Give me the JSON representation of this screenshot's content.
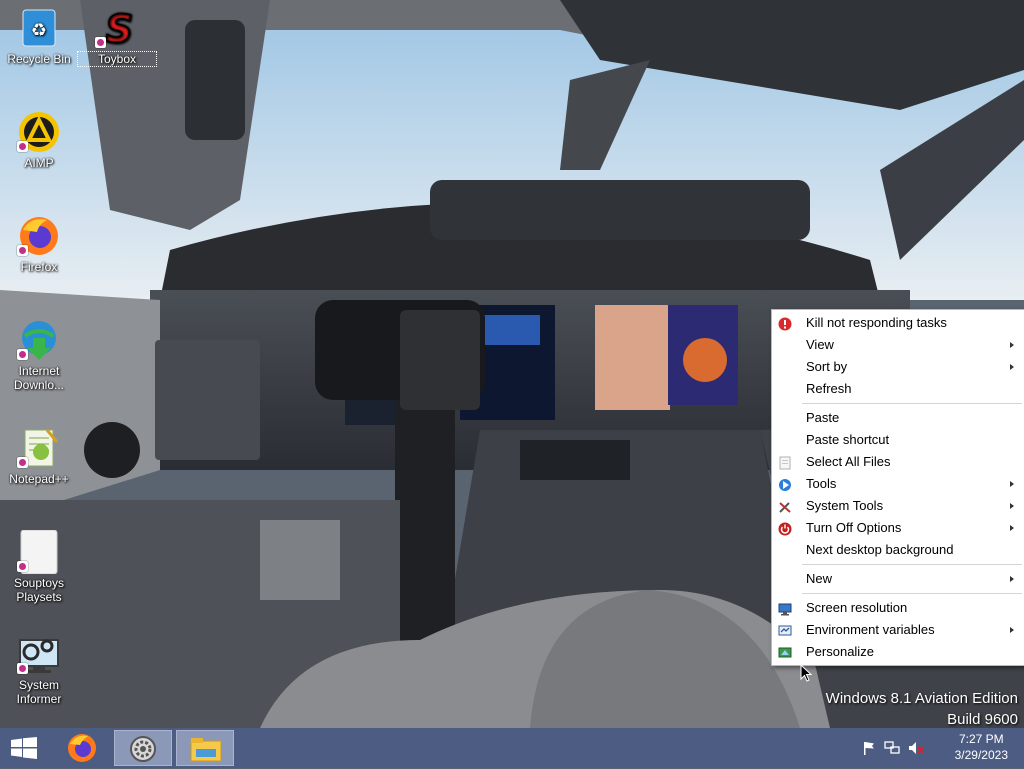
{
  "desktop": {
    "icons": [
      {
        "label": "Recycle Bin",
        "icon": "recycle-bin-icon"
      },
      {
        "label": "Toybox",
        "icon": "toybox-icon"
      },
      {
        "label": "AIMP",
        "icon": "aimp-icon"
      },
      {
        "label": "Firefox",
        "icon": "firefox-icon"
      },
      {
        "label": "Internet Downlo...",
        "icon": "internet-download-manager-icon"
      },
      {
        "label": "Notepad++",
        "icon": "notepad-plus-plus-icon"
      },
      {
        "label": "Souptoys Playsets",
        "icon": "souptoys-icon"
      },
      {
        "label": "System Informer",
        "icon": "system-informer-icon"
      }
    ]
  },
  "context_menu": {
    "items": [
      {
        "label": "Kill not responding tasks",
        "icon": "kill-task-icon",
        "submenu": false
      },
      {
        "label": "View",
        "icon": "",
        "submenu": true
      },
      {
        "label": "Sort by",
        "icon": "",
        "submenu": true
      },
      {
        "label": "Refresh",
        "icon": "",
        "submenu": false
      },
      {
        "label": "Paste",
        "icon": "",
        "submenu": false
      },
      {
        "label": "Paste shortcut",
        "icon": "",
        "submenu": false
      },
      {
        "label": "Select All Files",
        "icon": "select-all-icon",
        "submenu": false
      },
      {
        "label": "Tools",
        "icon": "tools-icon",
        "submenu": true
      },
      {
        "label": "System Tools",
        "icon": "system-tools-icon",
        "submenu": true
      },
      {
        "label": "Turn Off Options",
        "icon": "power-icon",
        "submenu": true
      },
      {
        "label": "Next desktop background",
        "icon": "",
        "submenu": false
      },
      {
        "label": "New",
        "icon": "",
        "submenu": true
      },
      {
        "label": "Screen resolution",
        "icon": "monitor-icon",
        "submenu": false
      },
      {
        "label": "Environment variables",
        "icon": "environment-icon",
        "submenu": true
      },
      {
        "label": "Personalize",
        "icon": "personalize-icon",
        "submenu": false
      }
    ]
  },
  "watermark": {
    "line1": "Windows 8.1 Aviation Edition",
    "line2": "Build 9600"
  },
  "taskbar": {
    "start": "start-icon",
    "pinned": [
      "firefox-icon",
      "settings-icon",
      "file-explorer-icon"
    ],
    "tray": [
      "flag-icon",
      "network-icon",
      "volume-muted-icon"
    ],
    "time": "7:27 PM",
    "date": "3/29/2023"
  },
  "colors": {
    "taskbar": "#4c5c82",
    "menu_bg": "#ffffff",
    "kill_icon": "#d92b2b",
    "power_icon": "#c42020"
  }
}
